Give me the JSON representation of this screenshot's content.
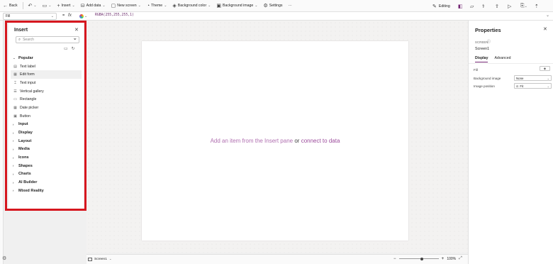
{
  "toolbar": {
    "back": "Back",
    "insert": "Insert",
    "add_data": "Add data",
    "new_screen": "New screen",
    "theme": "Theme",
    "background_color": "Background color",
    "background_image": "Background image",
    "settings": "Settings",
    "more": "···",
    "editing": "Editing"
  },
  "formula_bar": {
    "property": "Fill",
    "equals": "=",
    "fx": "fx",
    "formula": "RGBA(255,255,255,1)"
  },
  "insert_pane": {
    "title": "Insert",
    "search_placeholder": "Search",
    "popular": "Popular",
    "popular_items": [
      "Text label",
      "Edit form",
      "Text input",
      "Vertical gallery",
      "Rectangle",
      "Date picker",
      "Button"
    ],
    "categories": [
      "Input",
      "Display",
      "Layout",
      "Media",
      "Icons",
      "Shapes",
      "Charts",
      "AI Builder",
      "Mixed Reality"
    ]
  },
  "canvas": {
    "placeholder_prefix": "Add an item from the Insert pane",
    "placeholder_or": "or",
    "placeholder_link": "connect to data"
  },
  "status_bar": {
    "screen_tab": "Screen1",
    "zoom_minus": "−",
    "zoom_plus": "+",
    "zoom_level": "100%",
    "zoom_fraction": 0.55
  },
  "properties": {
    "title": "Properties",
    "kind": "SCREEN",
    "name": "Screen1",
    "tab_display": "Display",
    "tab_advanced": "Advanced",
    "fill_label": "Fill",
    "background_image_label": "Background image",
    "background_image_value": "None",
    "image_position_label": "Image position",
    "image_position_value": "Fit"
  },
  "colors": {
    "accent": "#742774",
    "highlight_border": "#d6171f"
  }
}
